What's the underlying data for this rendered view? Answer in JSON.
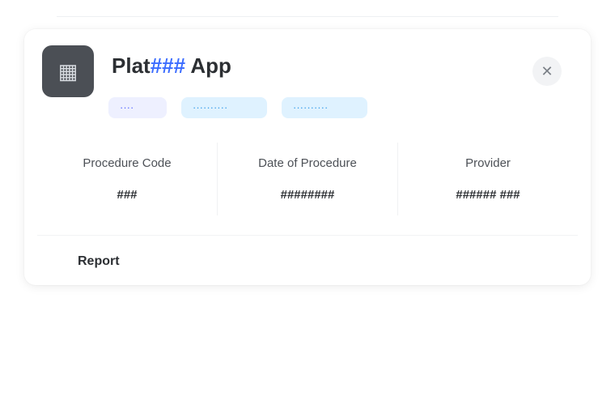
{
  "app": {
    "icon": "app-icon",
    "title_part1": "Plat",
    "title_accent": "###",
    "title_part2": " App"
  },
  "badges": [
    {
      "label": "····"
    },
    {
      "label": "··········"
    },
    {
      "label": "··········"
    }
  ],
  "close_icon": "close-icon",
  "info": [
    {
      "label": "Procedure Code",
      "value": "###"
    },
    {
      "label": "Date of Procedure",
      "value": "########"
    },
    {
      "label": "Provider",
      "value": "###### ###"
    }
  ],
  "report_label": "Report"
}
